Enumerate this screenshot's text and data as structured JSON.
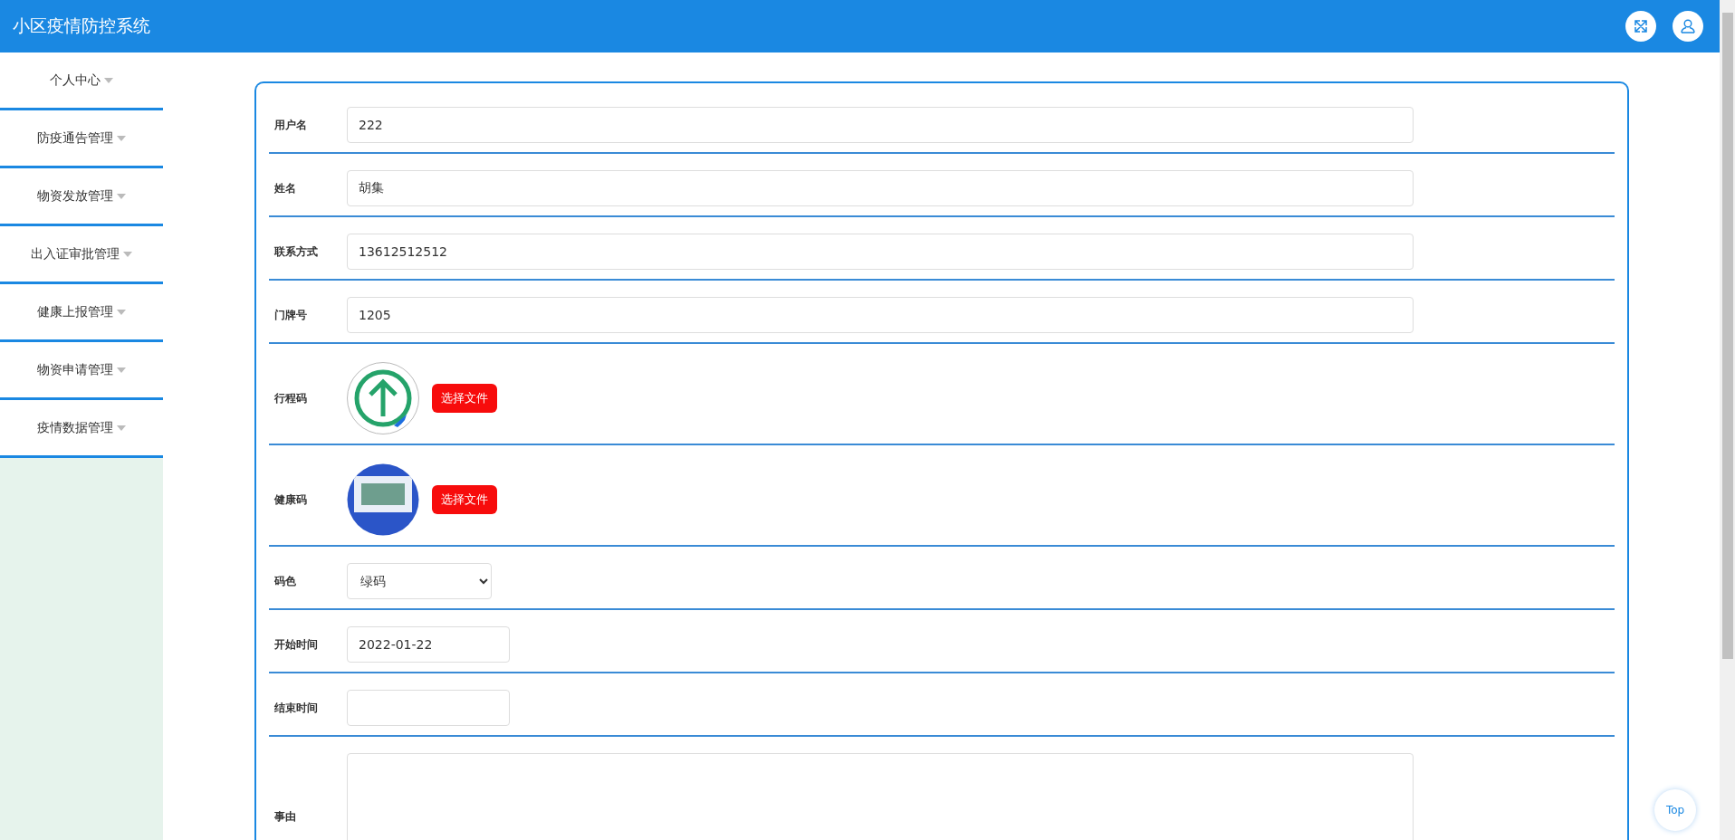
{
  "header": {
    "title": "小区疫情防控系统"
  },
  "sidebar": {
    "items": [
      {
        "label": "个人中心"
      },
      {
        "label": "防疫通告管理"
      },
      {
        "label": "物资发放管理"
      },
      {
        "label": "出入证审批管理"
      },
      {
        "label": "健康上报管理"
      },
      {
        "label": "物资申请管理"
      },
      {
        "label": "疫情数据管理"
      }
    ]
  },
  "form": {
    "fields": [
      {
        "kind": "text",
        "label": "用户名",
        "value": "222"
      },
      {
        "kind": "text",
        "label": "姓名",
        "value": "胡集"
      },
      {
        "kind": "text",
        "label": "联系方式",
        "value": "13612512512"
      },
      {
        "kind": "text",
        "label": "门牌号",
        "value": "1205"
      },
      {
        "kind": "image",
        "label": "行程码",
        "button": "选择文件"
      },
      {
        "kind": "image",
        "label": "健康码",
        "button": "选择文件"
      },
      {
        "kind": "select",
        "label": "码色",
        "value": "绿码"
      },
      {
        "kind": "date",
        "label": "开始时间",
        "value": "2022-01-22"
      },
      {
        "kind": "date",
        "label": "结束时间"
      },
      {
        "kind": "textarea",
        "label": "事由"
      }
    ]
  },
  "back_to_top": "Top"
}
